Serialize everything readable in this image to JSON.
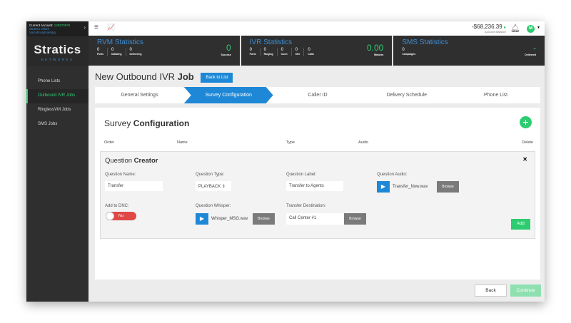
{
  "account": {
    "label": "Current Account:",
    "number": "128970876",
    "client": "Stratics Client",
    "product": "Voicebroadcasting"
  },
  "logo": {
    "name": "Stratics",
    "sub": "NETWORKS"
  },
  "nav": [
    "Phone Lists",
    "Outbound IVR Jobs",
    "RinglessVM Jobs",
    "SMS Jobs"
  ],
  "header": {
    "balance": "-$68,236.39",
    "balance_label": "Account Balance",
    "avatar": "M"
  },
  "stats": {
    "rvm": {
      "title": "RVM Statistics",
      "cells": [
        {
          "v": "0",
          "l": "Ports"
        },
        {
          "v": "0",
          "l": "Initiating"
        },
        {
          "v": "0",
          "l": "Delivering"
        }
      ],
      "big": "0",
      "big_label": "Success"
    },
    "ivr": {
      "title": "IVR Statistics",
      "cells": [
        {
          "v": "0",
          "l": "Ports"
        },
        {
          "v": "0",
          "l": "Ringing"
        },
        {
          "v": "0",
          "l": "Conn"
        },
        {
          "v": "0",
          "l": "Xfer"
        },
        {
          "v": "0",
          "l": "Calls"
        }
      ],
      "big": "0.00",
      "big_label": "Minutes"
    },
    "sms": {
      "title": "SMS Statistics",
      "cells": [
        {
          "v": "0",
          "l": "Campaigns"
        }
      ],
      "big": "-",
      "big_label": "Delivered"
    }
  },
  "page": {
    "title_a": "New Outbound IVR ",
    "title_b": "Job",
    "back_to_list": "Back to List"
  },
  "steps": [
    "General Settings",
    "Survey Configuration",
    "Caller ID",
    "Delivery Schedule",
    "Phone List"
  ],
  "survey": {
    "title_a": "Survey ",
    "title_b": "Configuration",
    "columns": [
      "Order",
      "Name",
      "Type",
      "Audio",
      "Delete"
    ]
  },
  "creator": {
    "title_a": "Question ",
    "title_b": "Creator",
    "name_label": "Question Name:",
    "name_value": "Transfer",
    "type_label": "Question Type:",
    "type_value": "PLAYBACK ⇕",
    "qlabel_label": "Question Label:",
    "qlabel_value": "Transfer to Agents",
    "audio_label": "Question Audio:",
    "audio_file": "Transfer_Now.wav",
    "dnc_label": "Add to DNC:",
    "dnc_value": "No",
    "whisper_label": "Question Whisper:",
    "whisper_file": "Whisper_MSG.wav",
    "dest_label": "Transfer Destination:",
    "dest_value": "Call Center #1",
    "browse": "Browse",
    "add": "Add"
  },
  "footer": {
    "back": "Back",
    "continue": "Continue"
  }
}
